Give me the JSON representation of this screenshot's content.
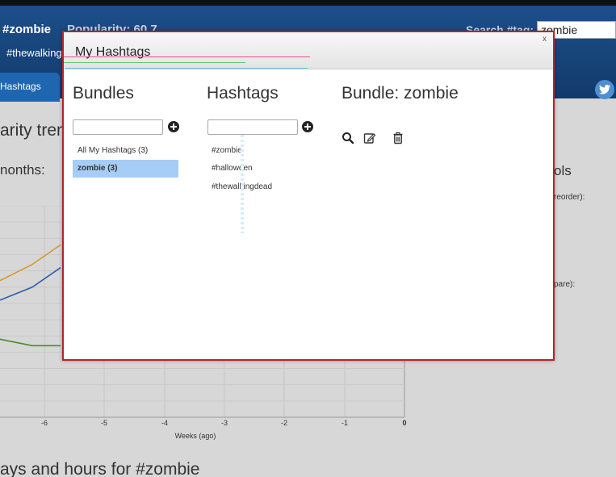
{
  "header": {
    "tag": "#zombie",
    "popularity": "Popularity: 60.7",
    "search_label": "Search #tag:",
    "search_value": "zombie",
    "sub_tag": "#thewalkingd",
    "tab_label": "Hashtags"
  },
  "background": {
    "heading_trend": "arity tren",
    "heading_months": "nonths:",
    "heading_tools": "ols",
    "reorder_note": "reorder):",
    "compare_note": "pare):",
    "heading_days": "ays and hours for #zombie"
  },
  "chart_data": {
    "type": "line",
    "xlabel": "Weeks (ago)",
    "x_ticks": [
      "-6",
      "-5",
      "-4",
      "-3",
      "-2",
      "-1",
      "0"
    ],
    "series": [
      {
        "color": "#d49a2c",
        "values": [
          4.2,
          4.7,
          5.3
        ]
      },
      {
        "color": "#2f5ea8",
        "values": [
          3.6,
          4.0,
          4.6
        ]
      },
      {
        "color": "#4b8a2c",
        "values": [
          2.4,
          2.2,
          2.2
        ]
      }
    ]
  },
  "modal": {
    "title": "My Hashtags",
    "close_label": "x",
    "bundles": {
      "heading": "Bundles",
      "items": [
        "All My Hashtags (3)",
        "zombie (3)"
      ],
      "selected_index": 1
    },
    "hashtags": {
      "heading": "Hashtags",
      "items": [
        "#zombie",
        "#halloween",
        "#thewalkingdead"
      ]
    },
    "bundle_detail": {
      "heading": "Bundle: zombie"
    }
  },
  "icons": [
    "plus-circle-icon",
    "search-icon",
    "edit-icon",
    "trash-icon",
    "twitter-icon"
  ],
  "colors": {
    "header_bg": "#1c4f8a",
    "modal_border": "#b3262b",
    "selected_bg": "#a5cdf6"
  }
}
